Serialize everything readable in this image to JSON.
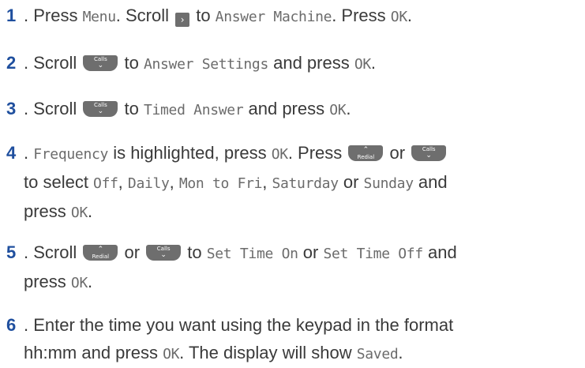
{
  "steps": {
    "s1": {
      "num": "1",
      "t1": ". Press ",
      "m1": "Menu",
      "t2": ". Scroll ",
      "arrow": "›",
      "t3": " to ",
      "m2": "Answer Machine",
      "t4": ". Press ",
      "m3": "OK",
      "t5": "."
    },
    "s2": {
      "num": "2",
      "t1": ". Scroll ",
      "key_label": "Calls",
      "t2": " to ",
      "m1": "Answer Settings",
      "t3": " and press ",
      "m2": "OK",
      "t4": "."
    },
    "s3": {
      "num": "3",
      "t1": ". Scroll ",
      "key_label": "Calls",
      "t2": " to ",
      "m1": "Timed Answer",
      "t3": " and press ",
      "m2": "OK",
      "t4": "."
    },
    "s4": {
      "num": "4",
      "t0": ". ",
      "m0": "Frequency",
      "t1": " is highlighted, press ",
      "m1": "OK",
      "t2": ". Press ",
      "redial_label": "Redial",
      "t3": " or ",
      "calls_label": "Calls",
      "t4": "to select ",
      "m2": "Off",
      "t5": ", ",
      "m3": "Daily",
      "t6": ", ",
      "m4": "Mon to Fri",
      "t7": ", ",
      "m5": "Saturday",
      "t8": " or ",
      "m6": "Sunday",
      "t9": " and",
      "t10": "press ",
      "m7": "OK",
      "t11": "."
    },
    "s5": {
      "num": "5",
      "t1": ". Scroll ",
      "redial_label": "Redial",
      "t2": " or ",
      "calls_label": "Calls",
      "t3": " to ",
      "m1": "Set Time On",
      "t4": " or ",
      "m2": "Set Time Off",
      "t5": " and",
      "t6": "press ",
      "m3": "OK",
      "t7": "."
    },
    "s6": {
      "num": "6",
      "t1": ". Enter the time you want using the keypad in the format",
      "t2": "hh:mm and press ",
      "m1": "OK",
      "t3": ". The display will show ",
      "m2": "Saved",
      "t4": "."
    }
  },
  "icons": {
    "scroll_right": "right-arrow-key-icon",
    "calls_key": "calls-down-key-icon",
    "redial_key": "redial-up-key-icon"
  },
  "colors": {
    "step_number": "#1f4f9e",
    "body_text": "#3a3a3a",
    "display_text": "#6b6b6b",
    "key_fill": "#6e6e6e"
  }
}
